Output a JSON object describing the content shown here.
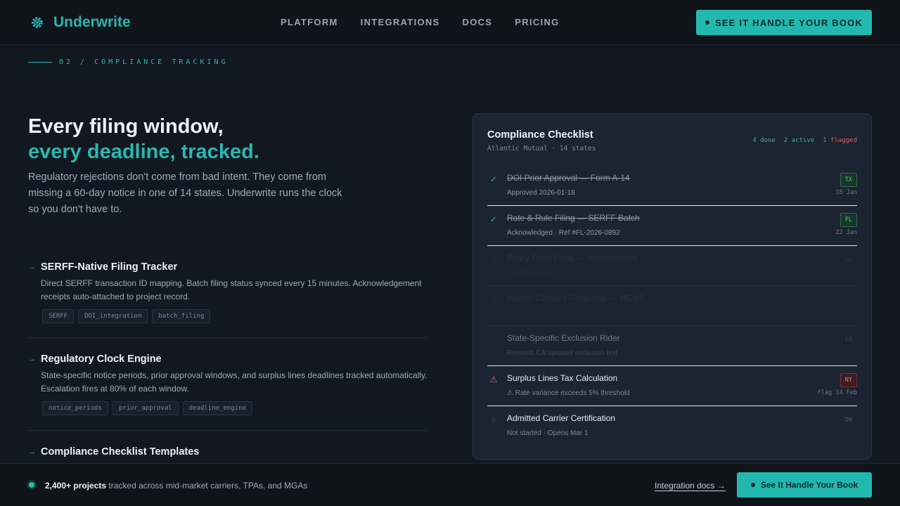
{
  "brand": {
    "name": "Underwrite",
    "icon": "gear-logo-icon"
  },
  "nav": {
    "links": [
      "PLATFORM",
      "INTEGRATIONS",
      "DOCS",
      "PRICING"
    ],
    "cta": "SEE IT HANDLE YOUR BOOK"
  },
  "section": {
    "eyebrow": "02 / COMPLIANCE TRACKING"
  },
  "hero": {
    "title_line1": "Every filing window,",
    "title_line2": "every deadline, tracked.",
    "lead": "Regulatory rejections don't come from bad intent. They come from missing a 60-day notice in one of 14 states. Underwrite runs the clock so you don't have to."
  },
  "features": [
    {
      "title": "SERFF-Native Filing Tracker",
      "desc": "Direct SERFF transaction ID mapping. Batch filing status synced every 15 minutes. Acknowledgement receipts auto-attached to project record.",
      "tags": [
        "SERFF",
        "DOI_integration",
        "batch_filing"
      ]
    },
    {
      "title": "Regulatory Clock Engine",
      "desc": "State-specific notice periods, prior approval windows, and surplus lines deadlines tracked automatically. Escalation fires at 80% of each window.",
      "tags": [
        "notice_periods",
        "prior_approval",
        "deadline_engine"
      ]
    },
    {
      "title": "Compliance Checklist Templates",
      "desc": "",
      "tags": []
    }
  ],
  "checklist": {
    "title": "Compliance Checklist",
    "subtitle": "Atlantic Mutual · 14 states",
    "counts": {
      "done": "4 done",
      "active": "2 active",
      "flagged": "1 flagged"
    },
    "items": [
      {
        "title": "DOI Prior Approval — Form A-14",
        "meta": "Approved 2026-01-18",
        "badge": "TX",
        "date": "18 Jan",
        "icon": "✓",
        "status": "done"
      },
      {
        "title": "Rate & Rule Filing — SERFF Batch",
        "meta": "Acknowledged · Ref #FL-2026-0892",
        "badge": "FL",
        "date": "22 Jan",
        "icon": "✓",
        "status": "done"
      },
      {
        "title": "Policy Form Filing — Homeowners",
        "meta": "Pending review",
        "badge": "GA",
        "date": "",
        "icon": "○",
        "status": "dim"
      },
      {
        "title": "Market Conduct Response — MCAS",
        "meta": "",
        "badge": "",
        "date": "",
        "icon": "○",
        "status": "dim"
      },
      {
        "title": "State-Specific Exclusion Rider",
        "meta": "Revised: CA updated exclusion text",
        "badge": "CA",
        "date": "",
        "icon": "",
        "status": "semidim"
      },
      {
        "title": "Surplus Lines Tax Calculation",
        "meta": "⚠ Rate variance exceeds 5% threshold",
        "badge": "NY",
        "date": "Flag 14 Feb",
        "icon": "⚠",
        "status": "flag"
      },
      {
        "title": "Admitted Carrier Certification",
        "meta": "Not started · Opens Mar 1",
        "badge": "OH",
        "date": "",
        "icon": "○",
        "status": "pending"
      }
    ]
  },
  "footer": {
    "count": "2,400+ projects",
    "text": " tracked across mid-market carriers, TPAs, and MGAs",
    "link": "Integration docs →",
    "cta": "See It Handle Your Book"
  },
  "colors": {
    "accent": "#2ab7b0",
    "background": "#111820",
    "card": "#1b2430",
    "done": "#3fb37f",
    "flag": "#e0605d"
  }
}
